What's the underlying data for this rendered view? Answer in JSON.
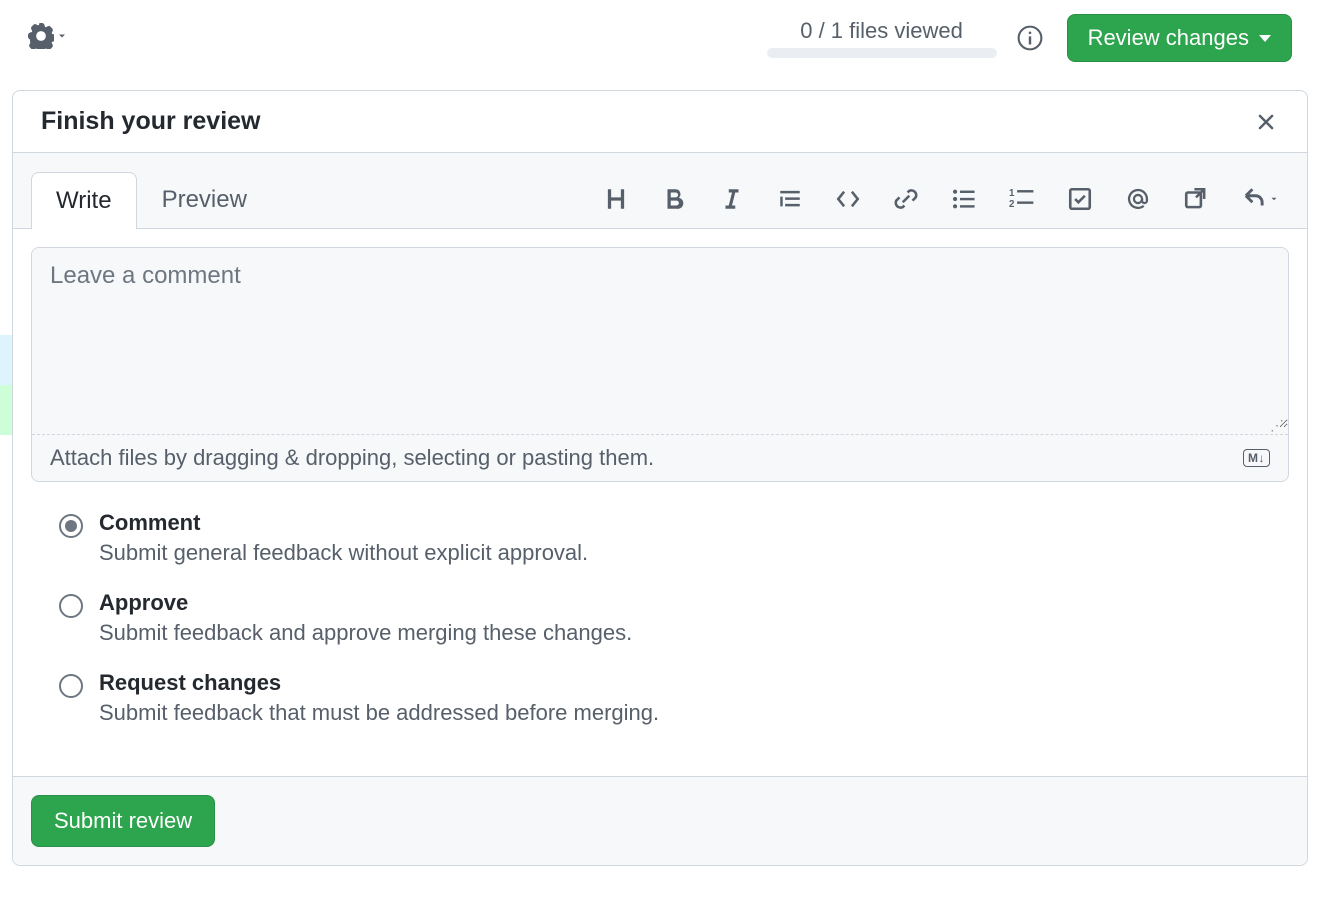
{
  "header": {
    "files_viewed": "0 / 1 files viewed",
    "review_changes_label": "Review changes"
  },
  "panel": {
    "title": "Finish your review",
    "tabs": {
      "write": "Write",
      "preview": "Preview"
    },
    "comment_placeholder": "Leave a comment",
    "attach_hint": "Attach files by dragging & dropping, selecting or pasting them.",
    "markdown_badge": "M↓"
  },
  "options": {
    "comment": {
      "label": "Comment",
      "desc": "Submit general feedback without explicit approval."
    },
    "approve": {
      "label": "Approve",
      "desc": "Submit feedback and approve merging these changes."
    },
    "request_changes": {
      "label": "Request changes",
      "desc": "Submit feedback that must be addressed before merging."
    }
  },
  "footer": {
    "submit_label": "Submit review"
  }
}
